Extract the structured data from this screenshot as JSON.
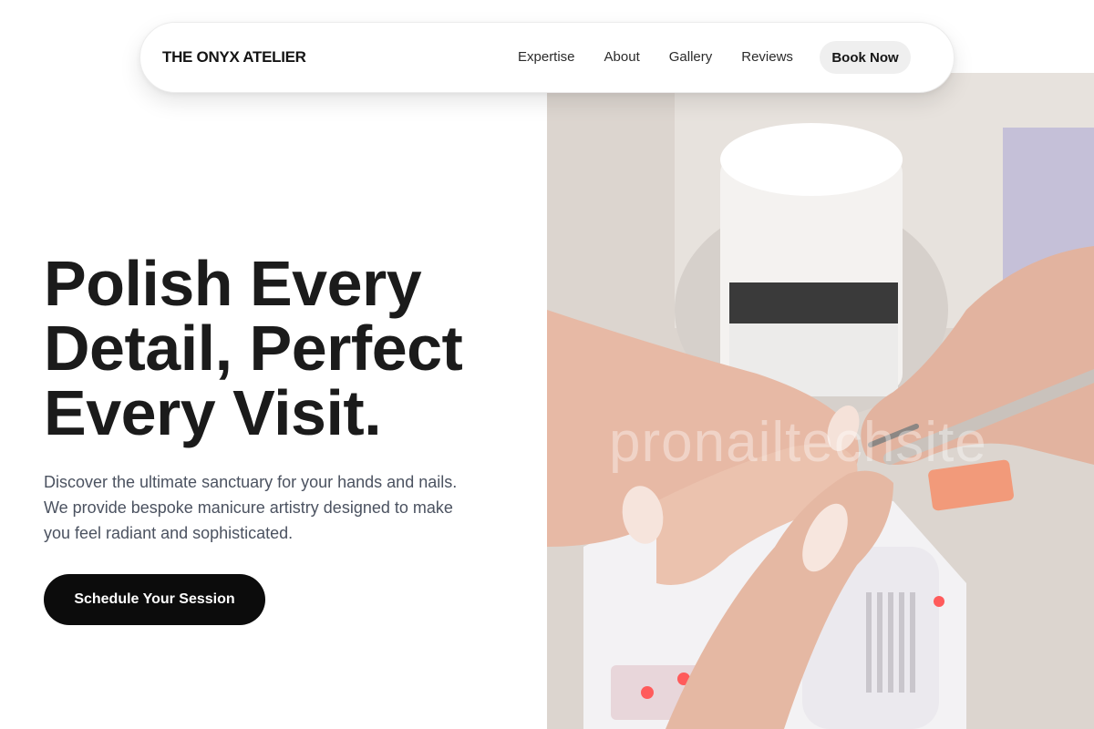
{
  "nav": {
    "brand": "THE ONYX ATELIER",
    "links": [
      "Expertise",
      "About",
      "Gallery",
      "Reviews"
    ],
    "book_label": "Book Now"
  },
  "hero": {
    "title_lines": [
      "Polish Every",
      "Detail, Perfect",
      "Every Visit."
    ],
    "description_lines": [
      "Discover the ultimate sanctuary for your hands and nails.",
      "We provide bespoke manicure artistry designed to make",
      "you feel radiant and sophisticated."
    ],
    "cta_label": "Schedule Your Session",
    "image_watermark": "pronailtechsite"
  },
  "colors": {
    "cta_background": "#0c0c0c",
    "book_button_background": "#efefef",
    "body_text": "#1b1b1b",
    "description_text": "#4b5260"
  }
}
